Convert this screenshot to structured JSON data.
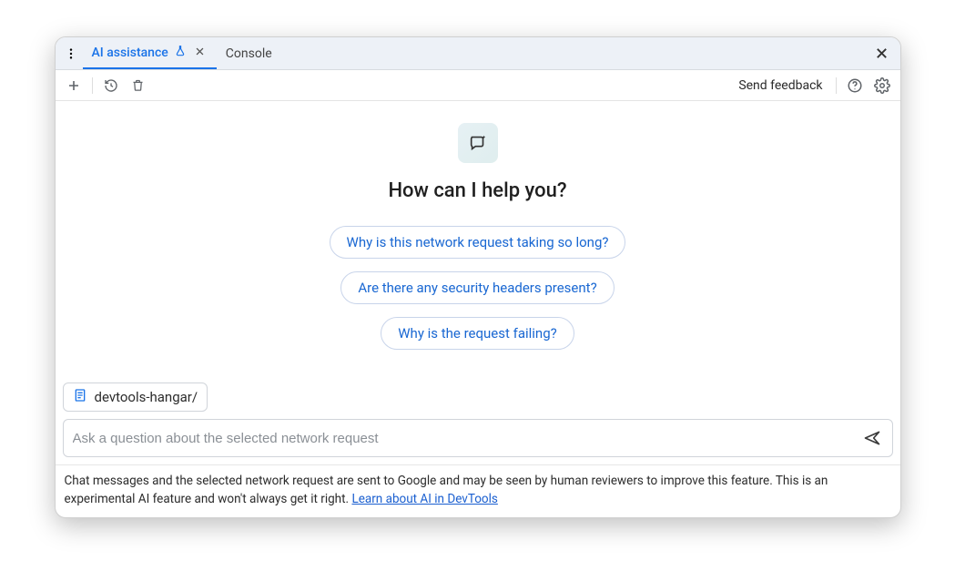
{
  "tabs": {
    "active": {
      "label": "AI assistance"
    },
    "items": [
      {
        "label": "Console"
      }
    ]
  },
  "toolbar": {
    "send_feedback": "Send feedback"
  },
  "hero": {
    "title": "How can I help you?"
  },
  "suggestions": [
    "Why is this network request taking so long?",
    "Are there any security headers present?",
    "Why is the request failing?"
  ],
  "context": {
    "label": "devtools-hangar/"
  },
  "input": {
    "placeholder": "Ask a question about the selected network request"
  },
  "disclaimer": {
    "text": "Chat messages and the selected network request are sent to Google and may be seen by human reviewers to improve this feature. This is an experimental AI feature and won't always get it right. ",
    "link_text": "Learn about AI in DevTools"
  }
}
